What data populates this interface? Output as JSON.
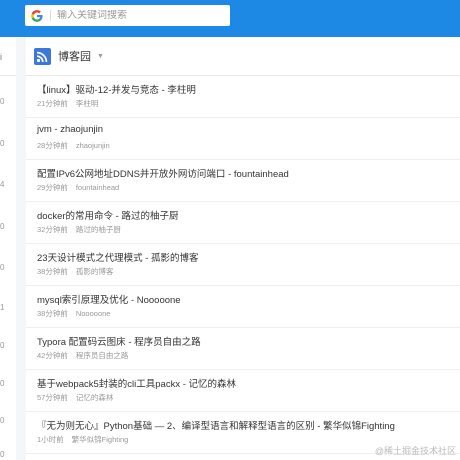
{
  "search": {
    "placeholder": "输入关键词搜索"
  },
  "left": {
    "header_char": "i",
    "counts": [
      "0",
      "0",
      "4",
      "0",
      "0",
      "1",
      "0",
      "0",
      "0",
      "0"
    ]
  },
  "feed": {
    "title": "博客园"
  },
  "items": [
    {
      "title": "【linux】驱动-12-并发与竞态 - 李柱明",
      "time": "21分钟前",
      "source": "李柱明"
    },
    {
      "title": "jvm - zhaojunjin",
      "time": "28分钟前",
      "source": "zhaojunjin"
    },
    {
      "title": "配置IPv6公网地址DDNS并开放外网访问端口 - fountainhead",
      "time": "29分钟前",
      "source": "fountainhead"
    },
    {
      "title": "docker的常用命令 - 路过的柚子厨",
      "time": "32分钟前",
      "source": "路过的柚子厨"
    },
    {
      "title": "23天设计模式之代理模式 - 孤影的博客",
      "time": "38分钟前",
      "source": "孤影的博客"
    },
    {
      "title": "mysql索引原理及优化 - Nooooone",
      "time": "38分钟前",
      "source": "Nooooone"
    },
    {
      "title": "Typora 配置码云图床 - 程序员自由之路",
      "time": "42分钟前",
      "source": "程序员自由之路"
    },
    {
      "title": "基于webpack5封装的cli工具packx - 记忆的森林",
      "time": "57分钟前",
      "source": "记忆的森林"
    },
    {
      "title": "『无为则无心』Python基础 — 2、编译型语言和解释型语言的区别 - 繁华似锦Fighting",
      "time": "1小时前",
      "source": "繁华似锦Fighting"
    }
  ],
  "watermark": "@稀土掘金技术社区"
}
